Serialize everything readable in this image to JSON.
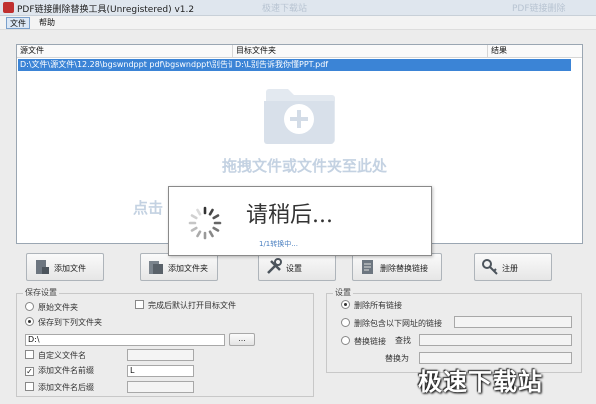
{
  "window": {
    "title": "PDF链接删除替换工具(Unregistered) v1.2",
    "title_watermark_left": "极速下载站",
    "title_watermark_right": "PDF链接删除"
  },
  "menu": {
    "items": [
      {
        "label": "文件",
        "active": true
      },
      {
        "label": "帮助",
        "active": false
      }
    ]
  },
  "file_list": {
    "columns": [
      "源文件",
      "目标文件夹",
      "结果"
    ],
    "rows": [
      {
        "source": "D:\\文件\\源文件\\12.28\\bgswndppt  pdf\\bgswndppt\\别告诉...",
        "target": "D:\\L别告诉我你懂PPT.pdf",
        "result": ""
      }
    ],
    "drop_hint_line1": "拖拽文件或文件夹至此处",
    "drop_hint_line2": "点击"
  },
  "progress_dialog": {
    "message": "请稍后...",
    "status": "1/1转换中..."
  },
  "toolbar": {
    "add_file": "添加文件",
    "add_folder": "添加文件夹",
    "settings": "设置",
    "delete_replace_links": "删除替换链接",
    "register": "注册"
  },
  "save_settings": {
    "title": "保存设置",
    "option_original_folder": "原始文件夹",
    "option_save_to_folder": "保存到下列文件夹",
    "open_target_after_finish": "完成后默认打开目标文件",
    "folder_path": "D:\\",
    "browse_label": "...",
    "custom_filename": "自定义文件名",
    "add_prefix": "添加文件名前缀",
    "prefix_value": "L",
    "add_suffix": "添加文件名后缀",
    "suffix_value": ""
  },
  "link_settings": {
    "title": "设置",
    "delete_all_links": "删除所有链接",
    "delete_links_containing_url": "删除包含以下网址的链接",
    "replace_links": "替换链接",
    "find_label": "查找",
    "replace_with_label": "替换为",
    "url_value": "",
    "find_value": "",
    "replace_value": ""
  },
  "watermark": {
    "text": "极速下载站"
  },
  "colors": {
    "selection": "#3b84d6",
    "accent_red": "#c03030"
  }
}
